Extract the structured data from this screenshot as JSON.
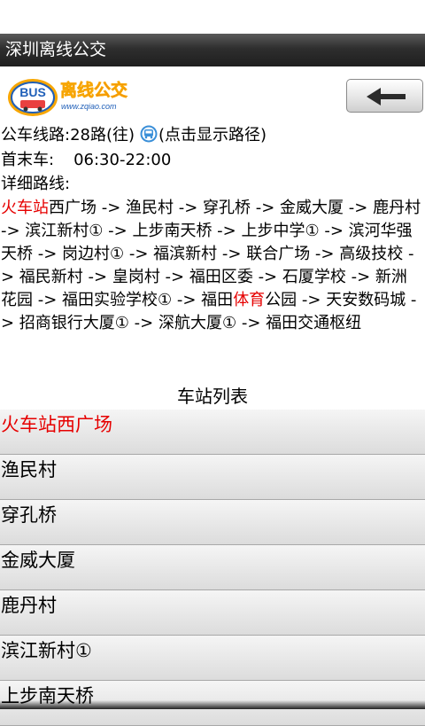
{
  "app": {
    "title": "深圳离线公交"
  },
  "logo": {
    "badge": "BUS",
    "name": "离线公交",
    "url": "www.zqiao.com"
  },
  "info": {
    "route_label": "公车线路:28路(往)",
    "show_path_hint": "(点击显示路径)",
    "time_label": "首末车:",
    "time_value": "06:30-22:00",
    "detail_label": "详细路线:"
  },
  "route_segments": [
    {
      "text": "火车站",
      "highlight": true
    },
    {
      "text": "西广场 -> 渔民村 -> 穿孔桥 -> 金威大厦 -> 鹿丹村 -> 滨江新村① -> 上步南天桥 -> 上步中学① -> 滨河华强天桥 -> 岗边村① -> 福滨新村 -> 联合广场 -> 高级技校 -> 福民新村 -> 皇岗村 -> 福田区委 -> 石厦学校 -> 新洲花园 -> 福田实验学校① -> 福田",
      "highlight": false
    },
    {
      "text": "体育",
      "highlight": true
    },
    {
      "text": "公园 -> 天安数码城 -> 招商银行大厦① -> 深航大厦① -> 福田交通枢纽",
      "highlight": false
    }
  ],
  "station_list": {
    "title": "车站列表",
    "stations": [
      "火车站西广场",
      "渔民村",
      "穿孔桥",
      "金威大厦",
      "鹿丹村",
      "滨江新村①",
      "上步南天桥"
    ]
  },
  "icons": {
    "back": "back-arrow-icon",
    "bus": "bus-route-icon"
  },
  "colors": {
    "highlight": "#e60000",
    "title_bar": "#2e2e2e"
  }
}
